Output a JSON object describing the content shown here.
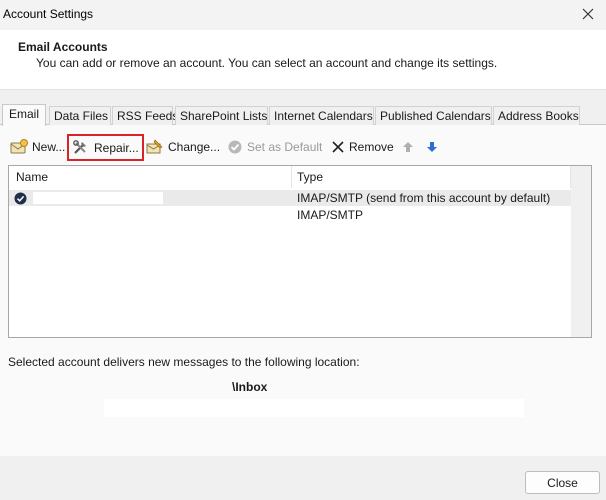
{
  "window": {
    "title": "Account Settings"
  },
  "header": {
    "title": "Email Accounts",
    "subtitle": "You can add or remove an account. You can select an account and change its settings."
  },
  "tabs": [
    {
      "label": "Email",
      "active": true
    },
    {
      "label": "Data Files"
    },
    {
      "label": "RSS Feeds"
    },
    {
      "label": "SharePoint Lists"
    },
    {
      "label": "Internet Calendars"
    },
    {
      "label": "Published Calendars"
    },
    {
      "label": "Address Books"
    }
  ],
  "toolbar": {
    "new_label": "New...",
    "repair_label": "Repair...",
    "change_label": "Change...",
    "set_default_label": "Set as Default",
    "remove_label": "Remove"
  },
  "accounts": {
    "columns": [
      "Name",
      "Type"
    ],
    "rows": [
      {
        "name": "",
        "type": "IMAP/SMTP (send from this account by default)",
        "default": true
      },
      {
        "name": "",
        "type": "IMAP/SMTP",
        "default": false
      }
    ]
  },
  "delivery": {
    "label": "Selected account delivers new messages to the following location:",
    "location": "\\Inbox"
  },
  "footer": {
    "close_label": "Close"
  },
  "colors": {
    "highlight": "#d9222a",
    "arrow_blue": "#2b6fd6"
  }
}
